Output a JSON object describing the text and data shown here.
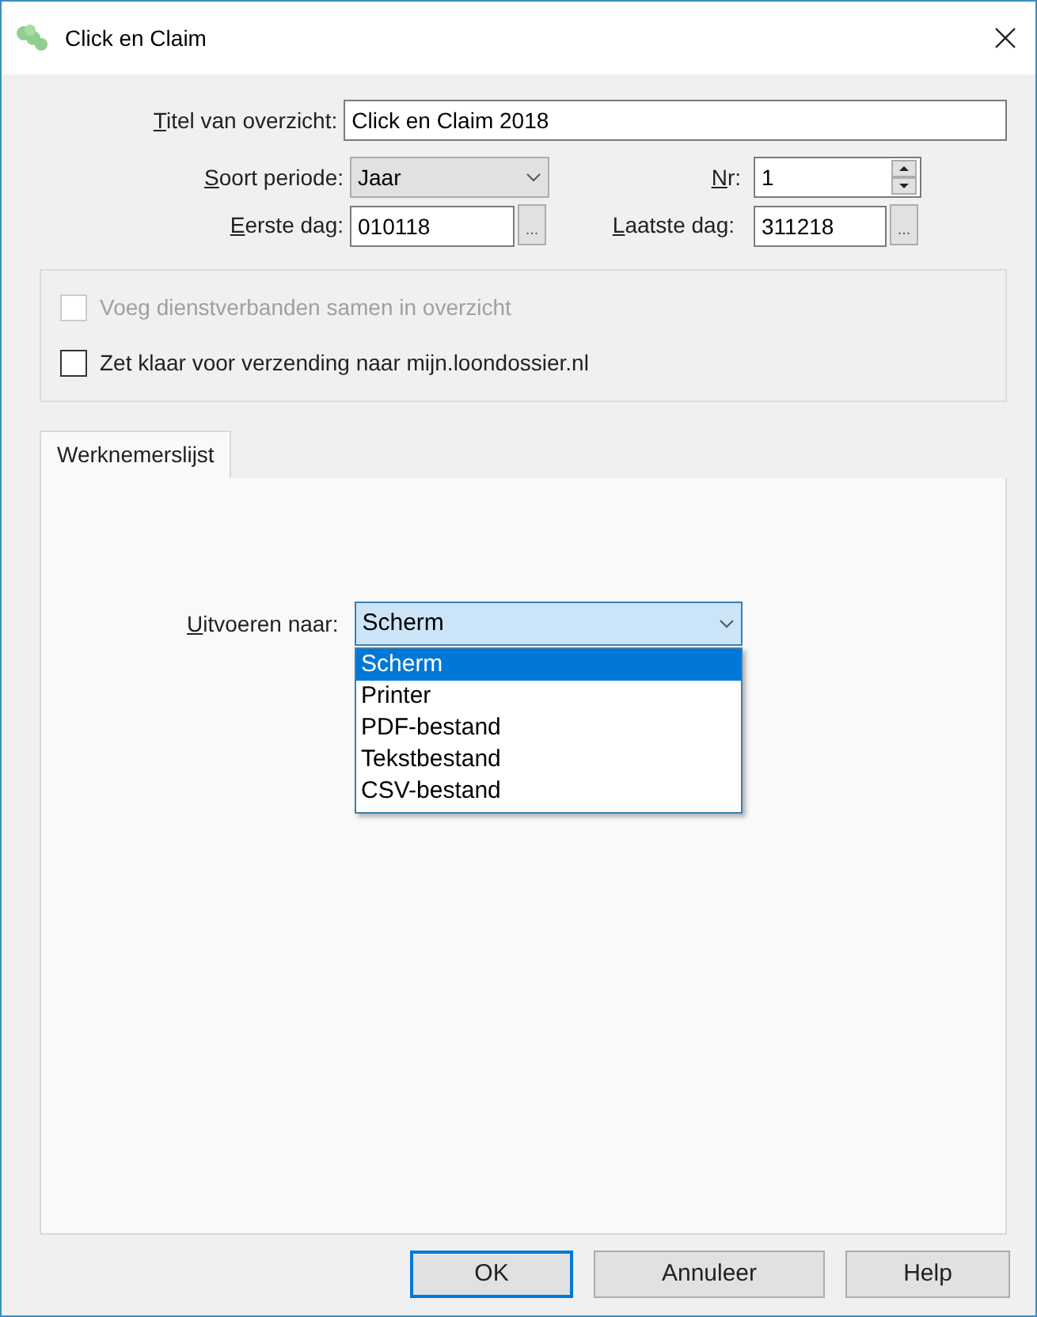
{
  "window": {
    "title": "Click en Claim"
  },
  "fields": {
    "title_label": "Titel van overzicht:",
    "title_value": "Click en Claim 2018",
    "period_label": "Soort periode:",
    "period_value": "Jaar",
    "nr_label": "Nr:",
    "nr_value": "1",
    "first_day_label": "Eerste dag:",
    "first_day_value": "010118",
    "last_day_label": "Laatste dag:",
    "last_day_value": "311218",
    "ellipsis": "..."
  },
  "options": [
    {
      "label": "Voeg dienstverbanden samen in overzicht",
      "checked": false,
      "disabled": true
    },
    {
      "label": "Zet klaar voor verzending naar mijn.loondossier.nl",
      "checked": false,
      "disabled": false
    }
  ],
  "tabs": [
    {
      "label": "Werknemerslijst",
      "selected": true
    }
  ],
  "output": {
    "label": "Uitvoeren naar:",
    "value": "Scherm",
    "expanded": true,
    "items": [
      {
        "label": "Scherm",
        "selected": true
      },
      {
        "label": "Printer",
        "selected": false
      },
      {
        "label": "PDF-bestand",
        "selected": false
      },
      {
        "label": "Tekstbestand",
        "selected": false
      },
      {
        "label": "CSV-bestand",
        "selected": false
      }
    ]
  },
  "buttons": [
    {
      "label": "OK",
      "default": true
    },
    {
      "label": "Annuleer",
      "default": false
    },
    {
      "label": "Help",
      "default": false
    }
  ]
}
